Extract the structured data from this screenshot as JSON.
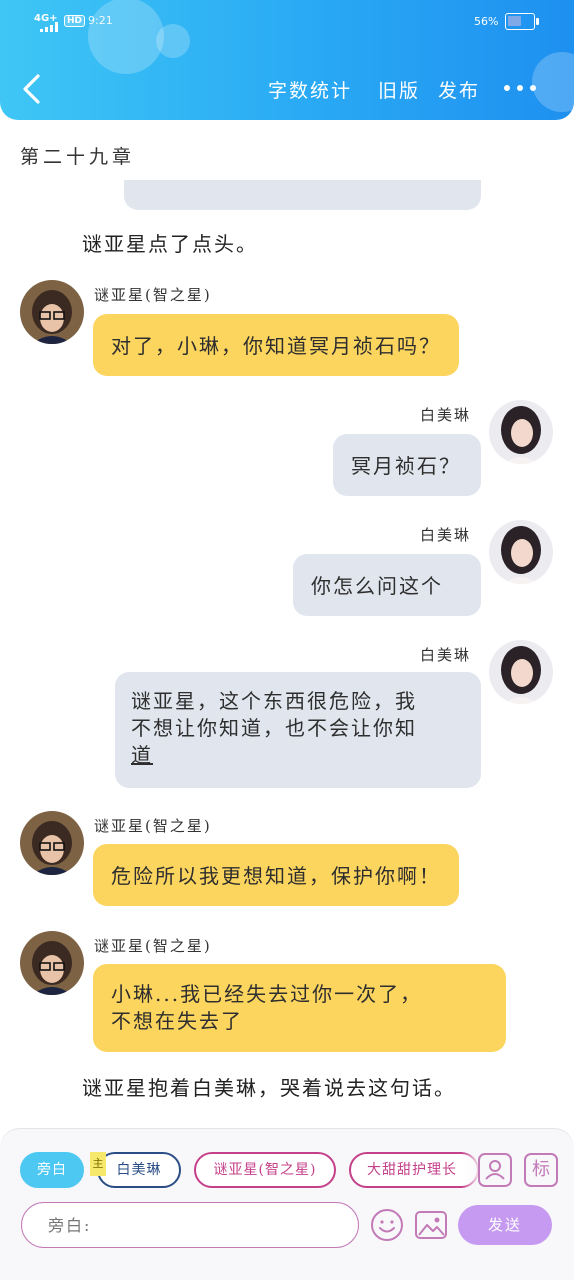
{
  "status_bar": {
    "network": "4G+",
    "hd": "HD",
    "time": "9:21",
    "battery_percent": "56%",
    "battery_level": 0.56
  },
  "header": {
    "back_icon": "chevron-left-icon",
    "actions": [
      {
        "label": "字数统计"
      },
      {
        "label": "旧版"
      },
      {
        "label": "发布"
      }
    ],
    "more_icon": "more-horizontal-icon",
    "gradient_colors": [
      "#3fc6f5",
      "#1e90f0"
    ]
  },
  "chapter_title": "第二十九章",
  "messages": [
    {
      "type": "narration",
      "text": "谜亚星点了点头。"
    },
    {
      "type": "left",
      "name": "谜亚星(智之星)",
      "text": "对了，小琳，你知道冥月祯石吗？"
    },
    {
      "type": "right",
      "name": "白美琳",
      "text": "冥月祯石？"
    },
    {
      "type": "right",
      "name": "白美琳",
      "text": "你怎么问这个"
    },
    {
      "type": "right",
      "name": "白美琳",
      "lines": [
        "谜亚星，这个东西很危险，我",
        "不想让你知道，也不会让你知",
        "道"
      ]
    },
    {
      "type": "left",
      "name": "谜亚星(智之星)",
      "text": "危险所以我更想知道，保护你啊！"
    },
    {
      "type": "left",
      "name": "谜亚星(智之星)",
      "lines": [
        "小琳...我已经失去过你一次了，",
        "不想在失去了"
      ]
    },
    {
      "type": "narration",
      "text": "谜亚星抱着白美琳，哭着说去这句话。"
    }
  ],
  "role_bar": {
    "narration_chip": "旁白",
    "main_tag": "主",
    "roles": [
      "白美琳",
      "谜亚星(智之星)",
      "大甜甜护理长"
    ],
    "add_role_icon": "user-card-icon",
    "tag_icon": "tag-icon",
    "tag_label": "标"
  },
  "composer": {
    "placeholder": "旁白:",
    "emoji_icon": "emoji-icon",
    "image_icon": "image-icon",
    "send_label": "发送"
  },
  "colors": {
    "yellow_bubble": "#fcd55f",
    "gray_bubble": "#e1e6ee",
    "accent_blue": "#4cc8f2",
    "accent_pink": "#c5408a",
    "send_purple": "#c59af0"
  }
}
